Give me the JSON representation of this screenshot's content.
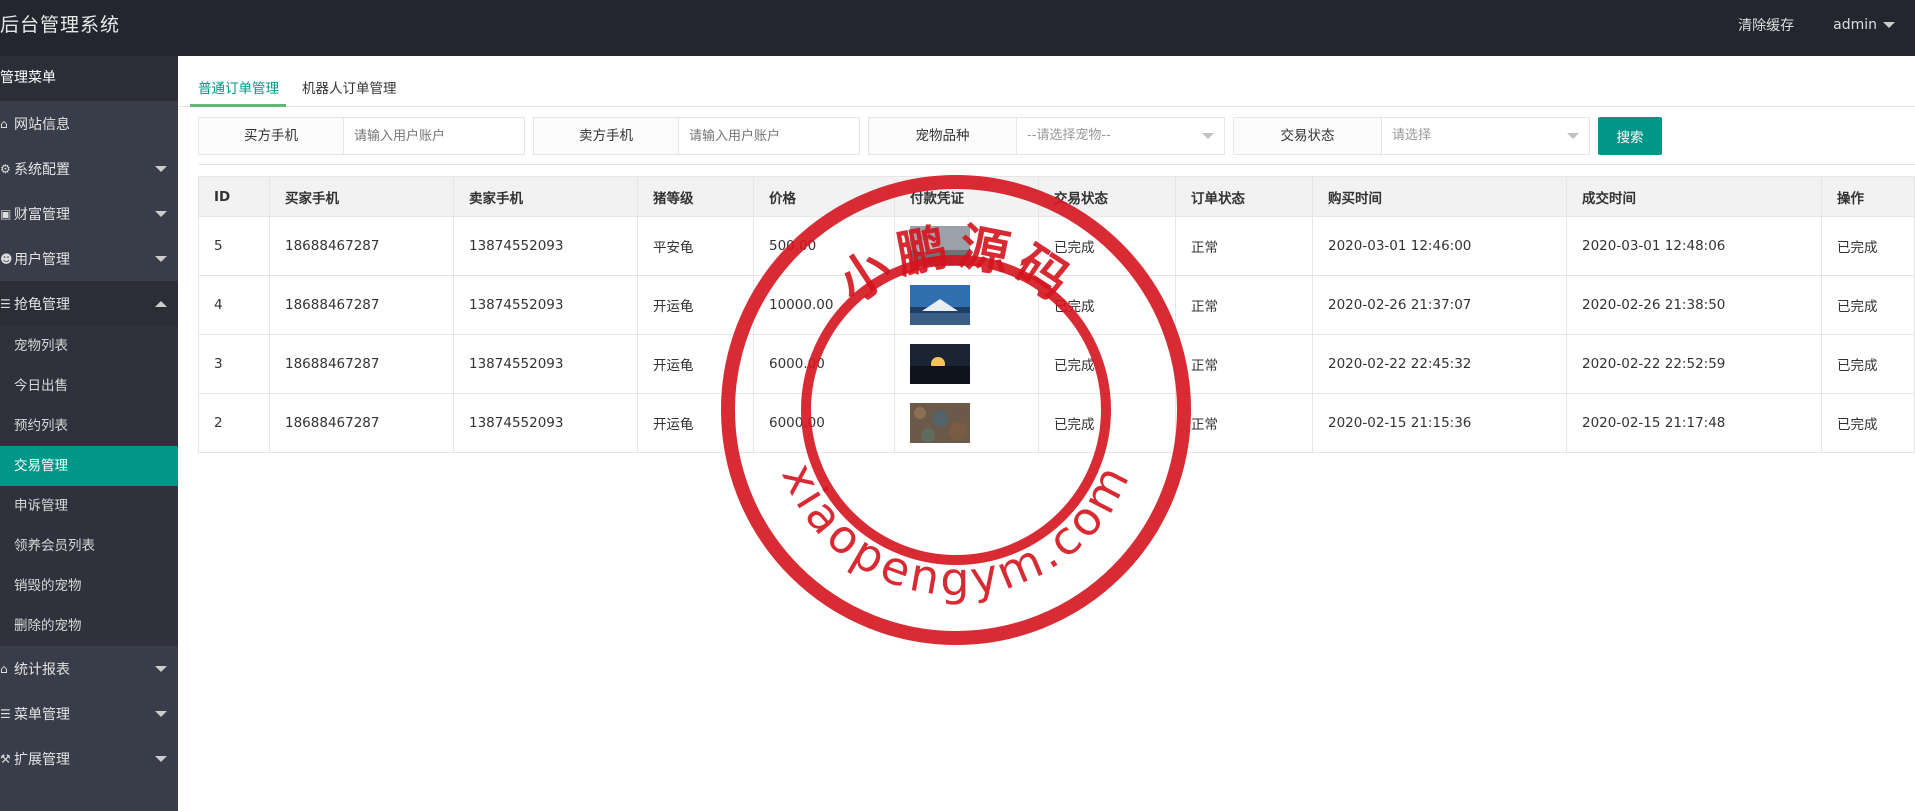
{
  "header": {
    "title": "后台管理系统",
    "clear_cache": "清除缓存",
    "user": "admin"
  },
  "sidebar": {
    "heading": "管理菜单",
    "items": [
      {
        "label": "网站信息",
        "icon": "home-icon",
        "caret": ""
      },
      {
        "label": "系统配置",
        "icon": "cogs-icon",
        "caret": "down"
      },
      {
        "label": "财富管理",
        "icon": "money-icon",
        "caret": "down"
      },
      {
        "label": "用户管理",
        "icon": "users-icon",
        "caret": "down"
      },
      {
        "label": "抢龟管理",
        "icon": "list-icon",
        "caret": "up"
      },
      {
        "label": "统计报表",
        "icon": "home-icon",
        "caret": "down"
      },
      {
        "label": "菜单管理",
        "icon": "list-icon",
        "caret": "down"
      },
      {
        "label": "扩展管理",
        "icon": "wrench-icon",
        "caret": "down"
      }
    ],
    "sub_items": [
      "宠物列表",
      "今日出售",
      "预约列表",
      "交易管理",
      "申诉管理",
      "领养会员列表",
      "销毁的宠物",
      "删除的宠物"
    ],
    "active_sub": "交易管理",
    "active_color": "#009688"
  },
  "tabs": [
    "普通订单管理",
    "机器人订单管理"
  ],
  "filters": {
    "buyer_label": "买方手机",
    "buyer_placeholder": "请输入用户账户",
    "seller_label": "卖方手机",
    "seller_placeholder": "请输入用户账户",
    "pet_label": "宠物品种",
    "pet_select": "--请选择宠物--",
    "status_label": "交易状态",
    "status_select": "请选择",
    "search": "搜索"
  },
  "table": {
    "headers": [
      "ID",
      "买家手机",
      "卖家手机",
      "猪等级",
      "价格",
      "付款凭证",
      "交易状态",
      "订单状态",
      "购买时间",
      "成交时间",
      "操作"
    ],
    "rows": [
      {
        "id": "5",
        "buyer": "18688467287",
        "seller": "13874552093",
        "level": "平安龟",
        "price": "500.00",
        "proof": "landscape-gray",
        "trade_status": "已完成",
        "order_status": "正常",
        "buy_time": "2020-03-01 12:46:00",
        "deal_time": "2020-03-01 12:48:06",
        "action": "已完成"
      },
      {
        "id": "4",
        "buyer": "18688467287",
        "seller": "13874552093",
        "level": "开运龟",
        "price": "10000.00",
        "proof": "mountain-sky",
        "trade_status": "已完成",
        "order_status": "正常",
        "buy_time": "2020-02-26 21:37:07",
        "deal_time": "2020-02-26 21:38:50",
        "action": "已完成"
      },
      {
        "id": "3",
        "buyer": "18688467287",
        "seller": "13874552093",
        "level": "开运龟",
        "price": "6000.00",
        "proof": "sunset",
        "trade_status": "已完成",
        "order_status": "正常",
        "buy_time": "2020-02-22 22:45:32",
        "deal_time": "2020-02-22 22:52:59",
        "action": "已完成"
      },
      {
        "id": "2",
        "buyer": "18688467287",
        "seller": "13874552093",
        "level": "开运龟",
        "price": "6000.00",
        "proof": "autumn-leaves",
        "trade_status": "已完成",
        "order_status": "正常",
        "buy_time": "2020-02-15 21:15:36",
        "deal_time": "2020-02-15 21:17:48",
        "action": "已完成"
      }
    ]
  },
  "watermark": {
    "top_text": "小鹏源码",
    "bottom_text": "xiaopengym.com",
    "color": "#d4141e"
  }
}
